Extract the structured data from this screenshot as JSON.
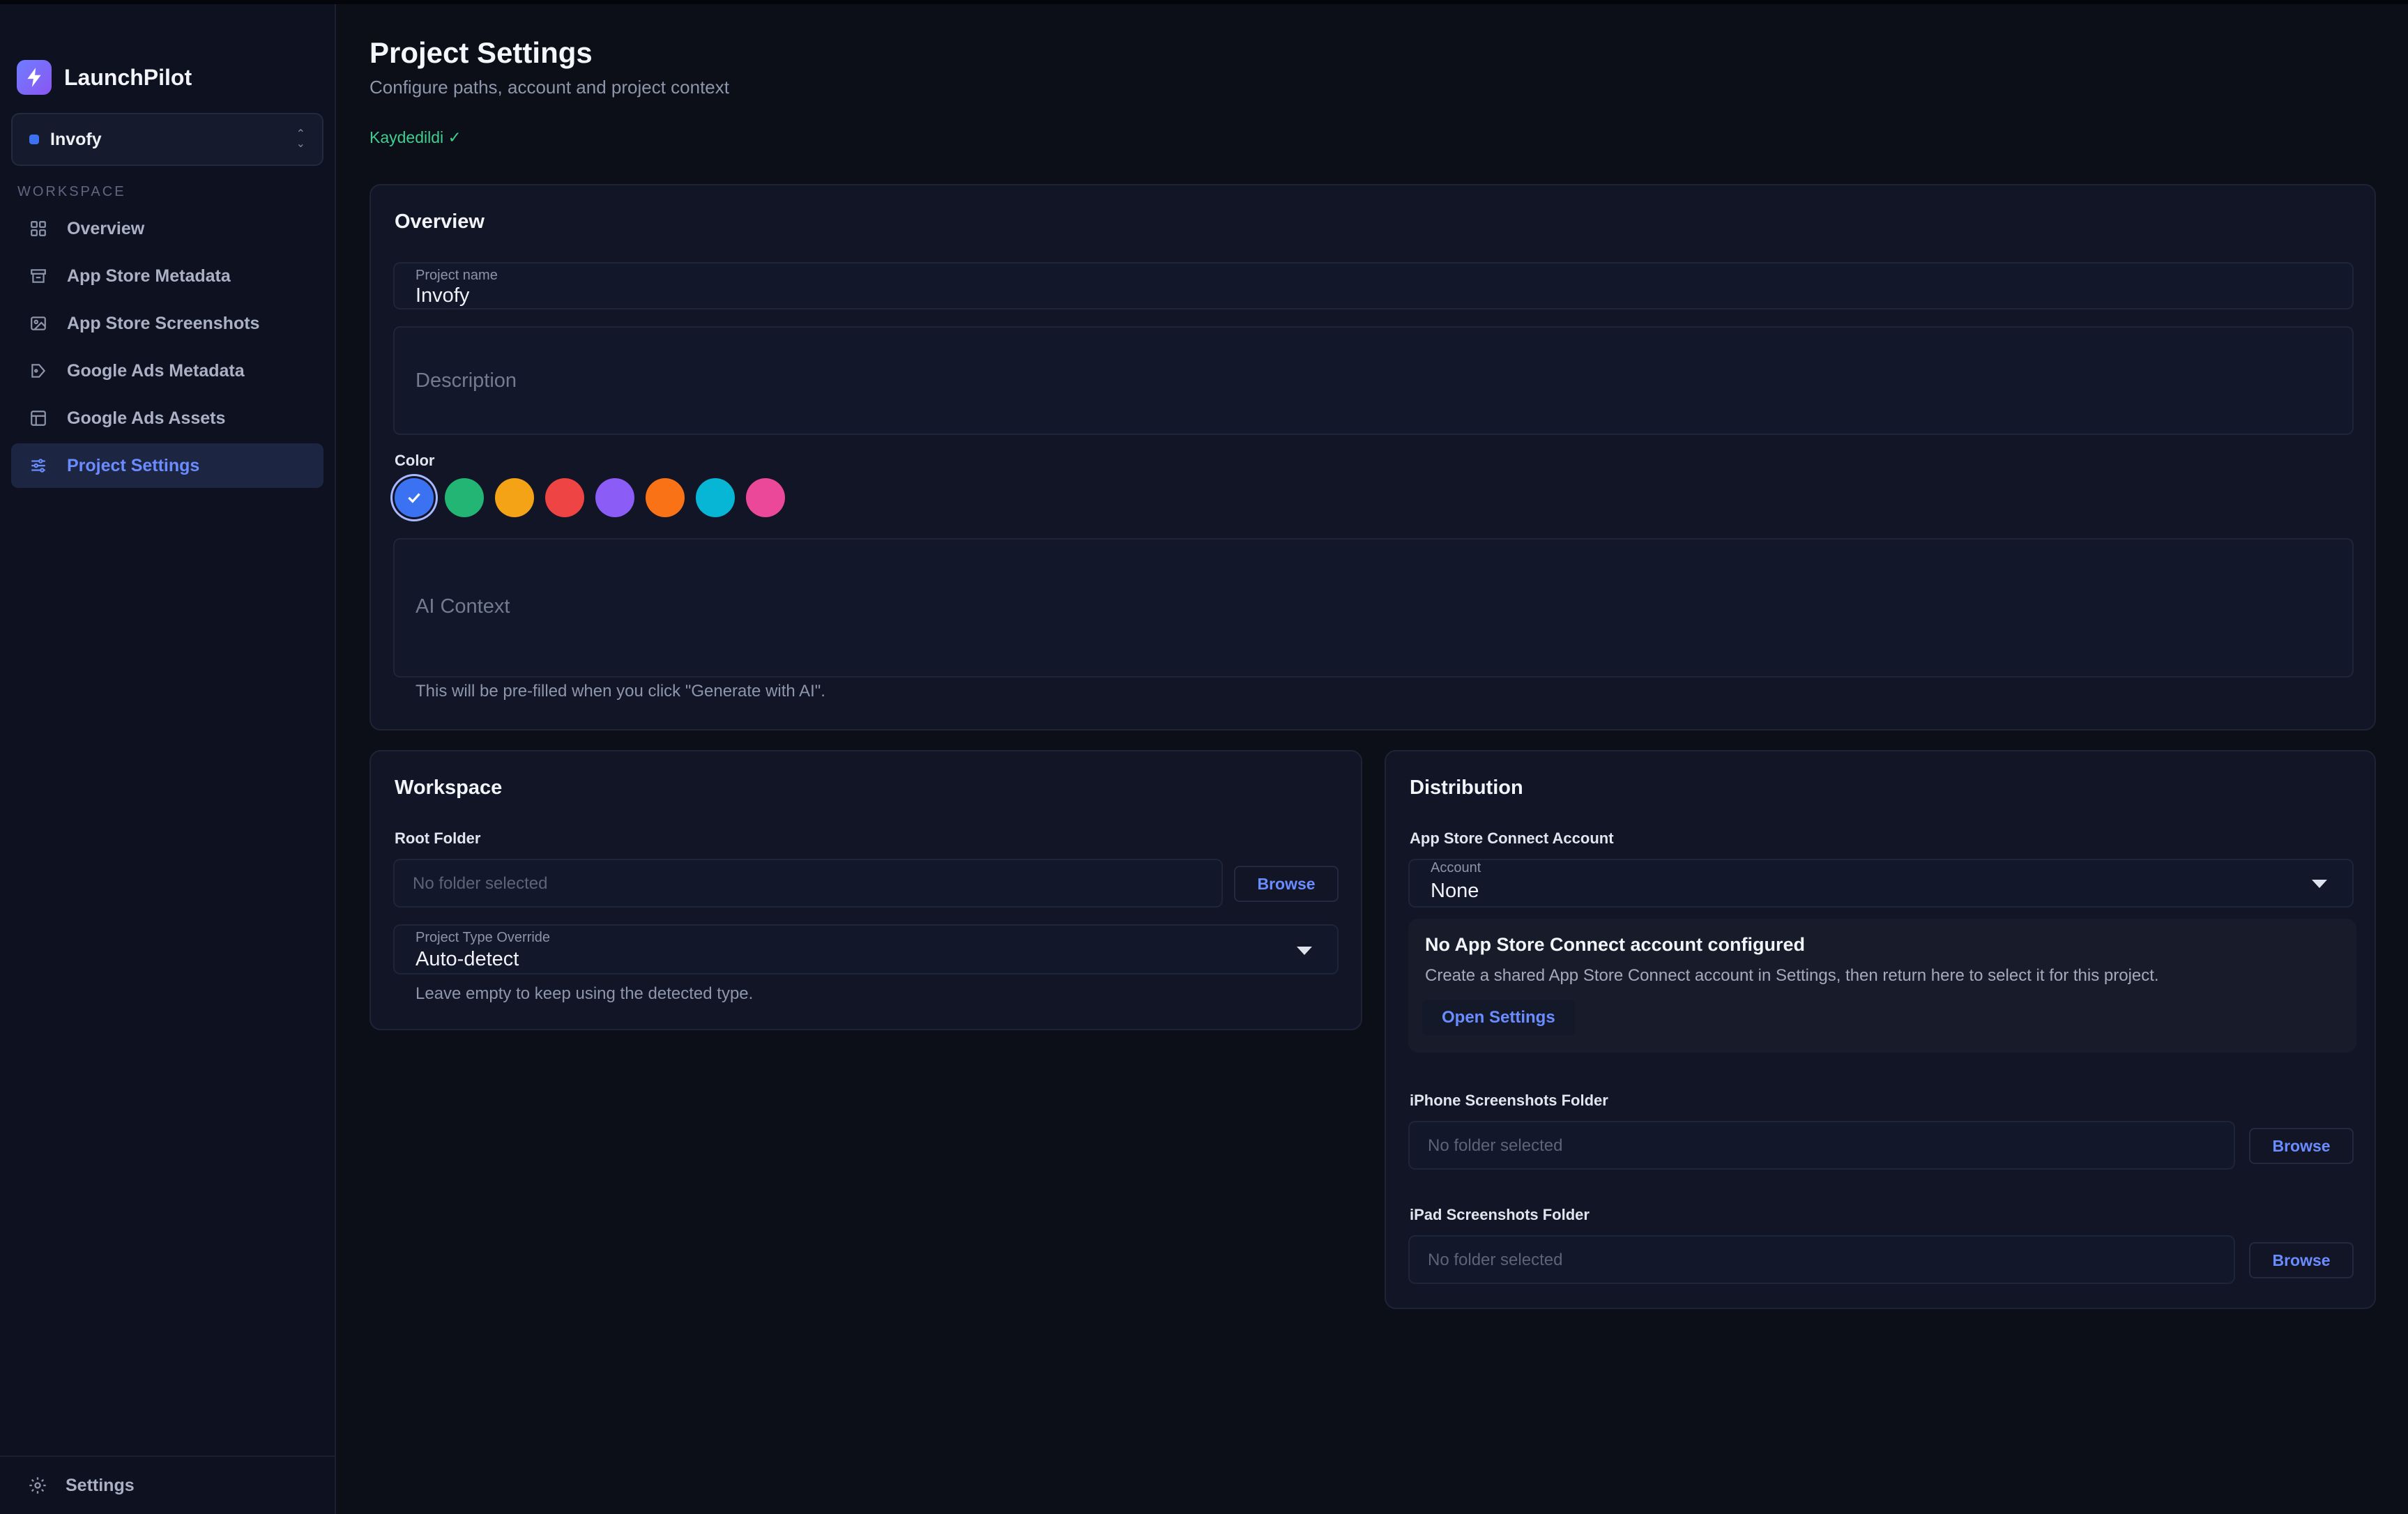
{
  "app": {
    "name": "LaunchPilot"
  },
  "project_selector": {
    "name": "Invofy",
    "color": "#3b72f2"
  },
  "sidebar": {
    "section_label": "WORKSPACE",
    "items": [
      {
        "label": "Overview",
        "icon": "grid-icon",
        "active": false
      },
      {
        "label": "App Store Metadata",
        "icon": "store-icon",
        "active": false
      },
      {
        "label": "App Store Screenshots",
        "icon": "images-icon",
        "active": false
      },
      {
        "label": "Google Ads Metadata",
        "icon": "ad-tag-icon",
        "active": false
      },
      {
        "label": "Google Ads Assets",
        "icon": "layout-icon",
        "active": false
      },
      {
        "label": "Project Settings",
        "icon": "sliders-icon",
        "active": true
      }
    ],
    "footer": {
      "label": "Settings",
      "icon": "gear-icon"
    }
  },
  "header": {
    "title": "Project Settings",
    "subtitle": "Configure paths, account and project context",
    "saved_status": "Kaydedildi ✓"
  },
  "overview": {
    "title": "Overview",
    "project_name_label": "Project name",
    "project_name_value": "Invofy",
    "description_placeholder": "Description",
    "color_label": "Color",
    "colors": [
      "#3b72f2",
      "#22b573",
      "#f4a316",
      "#ef4444",
      "#8b5cf6",
      "#f97316",
      "#06b6d4",
      "#ec4899"
    ],
    "selected_color": "#3b72f2",
    "ai_context_placeholder": "AI Context",
    "ai_context_hint": "This will be pre-filled when you click \"Generate with AI\"."
  },
  "workspace": {
    "title": "Workspace",
    "root_folder_label": "Root Folder",
    "root_folder_placeholder": "No folder selected",
    "browse_label": "Browse",
    "type_override_label": "Project Type Override",
    "type_override_value": "Auto-detect",
    "type_override_hint": "Leave empty to keep using the detected type."
  },
  "distribution": {
    "title": "Distribution",
    "asc_account_label": "App Store Connect Account",
    "account_field_label": "Account",
    "account_value": "None",
    "notice_title": "No App Store Connect account configured",
    "notice_text": "Create a shared App Store Connect account in Settings, then return here to select it for this project.",
    "notice_link": "Open Settings",
    "iphone_label": "iPhone Screenshots Folder",
    "iphone_placeholder": "No folder selected",
    "ipad_label": "iPad Screenshots Folder",
    "ipad_placeholder": "No folder selected",
    "browse_label": "Browse"
  }
}
